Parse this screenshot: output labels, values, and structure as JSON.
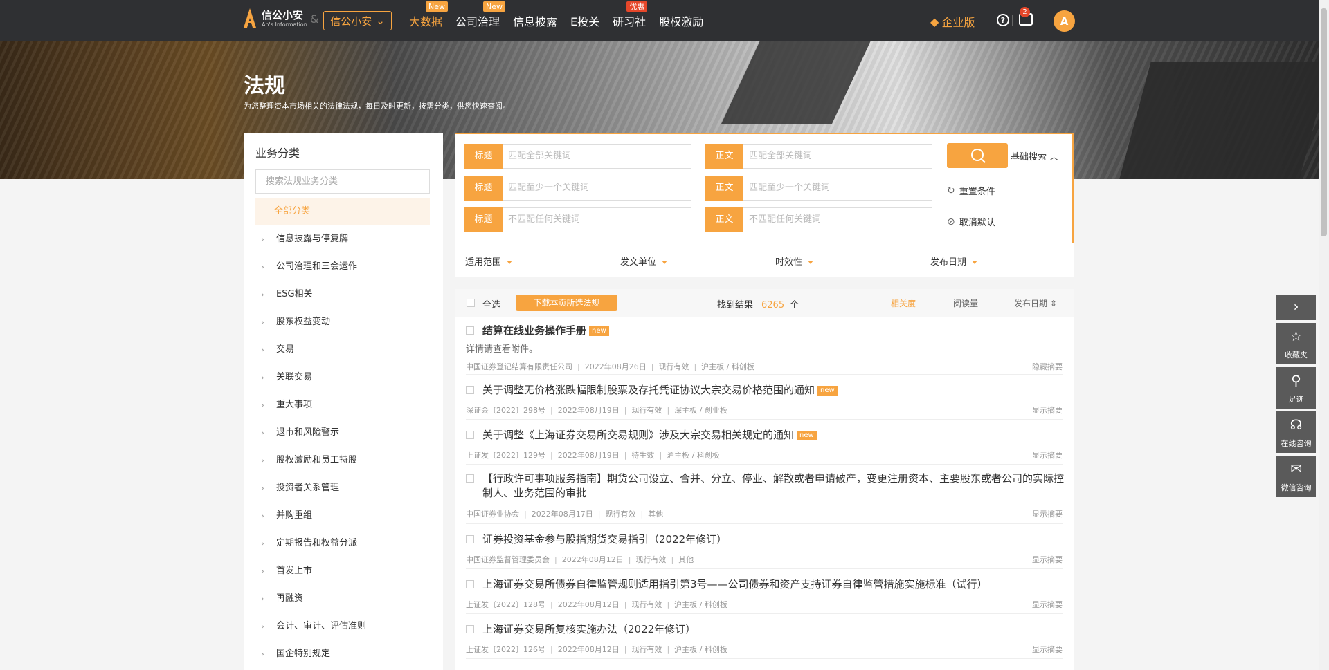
{
  "nav": {
    "brand_title": "信公小安",
    "brand_sub": "An's Information",
    "amp": "&",
    "brand_select": "信公小安",
    "links": [
      {
        "label": "大数据",
        "badge": "New"
      },
      {
        "label": "公司治理",
        "badge": "New"
      },
      {
        "label": "信息披露",
        "badge": ""
      },
      {
        "label": "E投关",
        "badge": ""
      },
      {
        "label": "研习社",
        "badge": "优惠"
      },
      {
        "label": "股权激励",
        "badge": ""
      }
    ],
    "enterprise": "企业版",
    "help": "?",
    "msg_count": "2",
    "avatar_letter": "A"
  },
  "banner": {
    "title": "法规",
    "subtitle": "为您整理资本市场相关的法律法规，每日及时更新，按需分类，供您快速查阅。"
  },
  "sidebar": {
    "title": "业务分类",
    "search_placeholder": "搜索法规业务分类",
    "all_label": "全部分类",
    "items": [
      "信息披露与停复牌",
      "公司治理和三会运作",
      "ESG相关",
      "股东权益变动",
      "交易",
      "关联交易",
      "重大事项",
      "退市和风险警示",
      "股权激励和员工持股",
      "投资者关系管理",
      "并购重组",
      "定期报告和权益分派",
      "首发上市",
      "再融资",
      "会计、审计、评估准则",
      "国企特别规定"
    ]
  },
  "search": {
    "rows": [
      {
        "left_tag": "标题",
        "left_ph": "匹配全部关键词",
        "right_tag": "正文",
        "right_ph": "匹配全部关键词"
      },
      {
        "left_tag": "标题",
        "left_ph": "匹配至少一个关键词",
        "right_tag": "正文",
        "right_ph": "匹配至少一个关键词"
      },
      {
        "left_tag": "标题",
        "left_ph": "不匹配任何关键词",
        "right_tag": "正文",
        "right_ph": "不匹配任何关键词"
      }
    ],
    "basic_search": "基础搜索 ︿",
    "reset": "重置条件",
    "cancel_default": "取消默认"
  },
  "filters": [
    "适用范围",
    "发文单位",
    "时效性",
    "发布日期"
  ],
  "results": {
    "select_all": "全选",
    "download_btn": "下载本页所选法规",
    "found_label": "找到结果",
    "found_count": "6265",
    "found_unit": "个",
    "sort": [
      "相关度",
      "阅读量",
      "发布日期 ⇕"
    ],
    "new_tag": "new",
    "items": [
      {
        "title": "结算在线业务操作手册",
        "is_new": true,
        "desc": "详情请查看附件。",
        "meta": [
          "中国证券登记结算有限责任公司",
          "2022年08月26日",
          "现行有效",
          "沪主板 / 科创板"
        ],
        "toggle": "隐藏摘要"
      },
      {
        "title": "关于调整无价格涨跌幅限制股票及存托凭证协议大宗交易价格范围的通知",
        "is_new": true,
        "desc": "",
        "meta": [
          "深证会〔2022〕298号",
          "2022年08月19日",
          "现行有效",
          "深主板 / 创业板"
        ],
        "toggle": "显示摘要"
      },
      {
        "title": "关于调整《上海证券交易所交易规则》涉及大宗交易相关规定的通知",
        "is_new": true,
        "desc": "",
        "meta": [
          "上证发〔2022〕129号",
          "2022年08月19日",
          "待生效",
          "沪主板 / 科创板"
        ],
        "toggle": "显示摘要"
      },
      {
        "title": "【行政许可事项服务指南】期货公司设立、合并、分立、停业、解散或者申请破产，变更注册资本、主要股东或者公司的实际控制人、业务范围的审批",
        "is_new": false,
        "desc": "",
        "meta": [
          "中国证券业协会",
          "2022年08月17日",
          "现行有效",
          "其他"
        ],
        "toggle": "显示摘要"
      },
      {
        "title": "证券投资基金参与股指期货交易指引（2022年修订）",
        "is_new": false,
        "desc": "",
        "meta": [
          "中国证券监督管理委员会",
          "2022年08月12日",
          "现行有效",
          "其他"
        ],
        "toggle": "显示摘要"
      },
      {
        "title": "上海证券交易所债券自律监管规则适用指引第3号——公司债券和资产支持证券自律监管措施实施标准（试行）",
        "is_new": false,
        "desc": "",
        "meta": [
          "上证发〔2022〕128号",
          "2022年08月12日",
          "现行有效",
          "沪主板 / 科创板"
        ],
        "toggle": "显示摘要"
      },
      {
        "title": "上海证券交易所复核实施办法（2022年修订）",
        "is_new": false,
        "desc": "",
        "meta": [
          "上证发〔2022〕126号",
          "2022年08月12日",
          "现行有效",
          "沪主板 / 科创板"
        ],
        "toggle": "显示摘要"
      }
    ]
  },
  "floatbar": [
    {
      "icon": "›",
      "label": ""
    },
    {
      "icon": "☆",
      "label": "收藏夹"
    },
    {
      "icon": "⚲",
      "label": "足迹"
    },
    {
      "icon": "☊",
      "label": "在线咨询"
    },
    {
      "icon": "✉",
      "label": "微信咨询"
    }
  ],
  "colors": {
    "accent": "#f7a440",
    "nav_bg": "#2f3033",
    "float_bg": "#5a5a5a"
  }
}
